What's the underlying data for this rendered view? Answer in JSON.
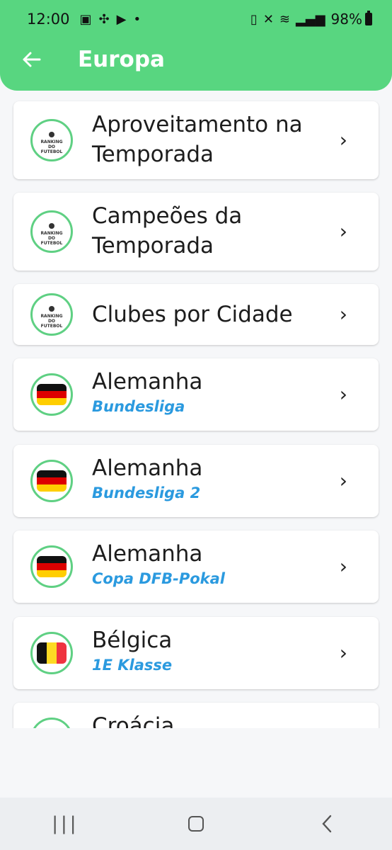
{
  "status_bar": {
    "time": "12:00",
    "battery": "98%"
  },
  "app_bar": {
    "title": "Europa",
    "back_glyph": "←"
  },
  "items": [
    {
      "title": "Aproveitamento na Temporada",
      "subtitle": "",
      "icon": "ranking-logo"
    },
    {
      "title": "Campeões da Temporada",
      "subtitle": "",
      "icon": "ranking-logo"
    },
    {
      "title": "Clubes por Cidade",
      "subtitle": "",
      "icon": "ranking-logo"
    },
    {
      "title": "Alemanha",
      "subtitle": "Bundesliga",
      "icon": "germany-flag"
    },
    {
      "title": "Alemanha",
      "subtitle": "Bundesliga 2",
      "icon": "germany-flag"
    },
    {
      "title": "Alemanha",
      "subtitle": "Copa DFB-Pokal",
      "icon": "germany-flag"
    },
    {
      "title": "Bélgica",
      "subtitle": "1E Klasse",
      "icon": "belgium-flag"
    },
    {
      "title": "Croácia",
      "subtitle": "",
      "icon": "croatia-flag"
    }
  ],
  "logo_text": "RANKING DO FUTEBOL",
  "colors": {
    "accent": "#58d680",
    "subtitle": "#2b9adf",
    "avatar_ring": "#5fd083"
  }
}
